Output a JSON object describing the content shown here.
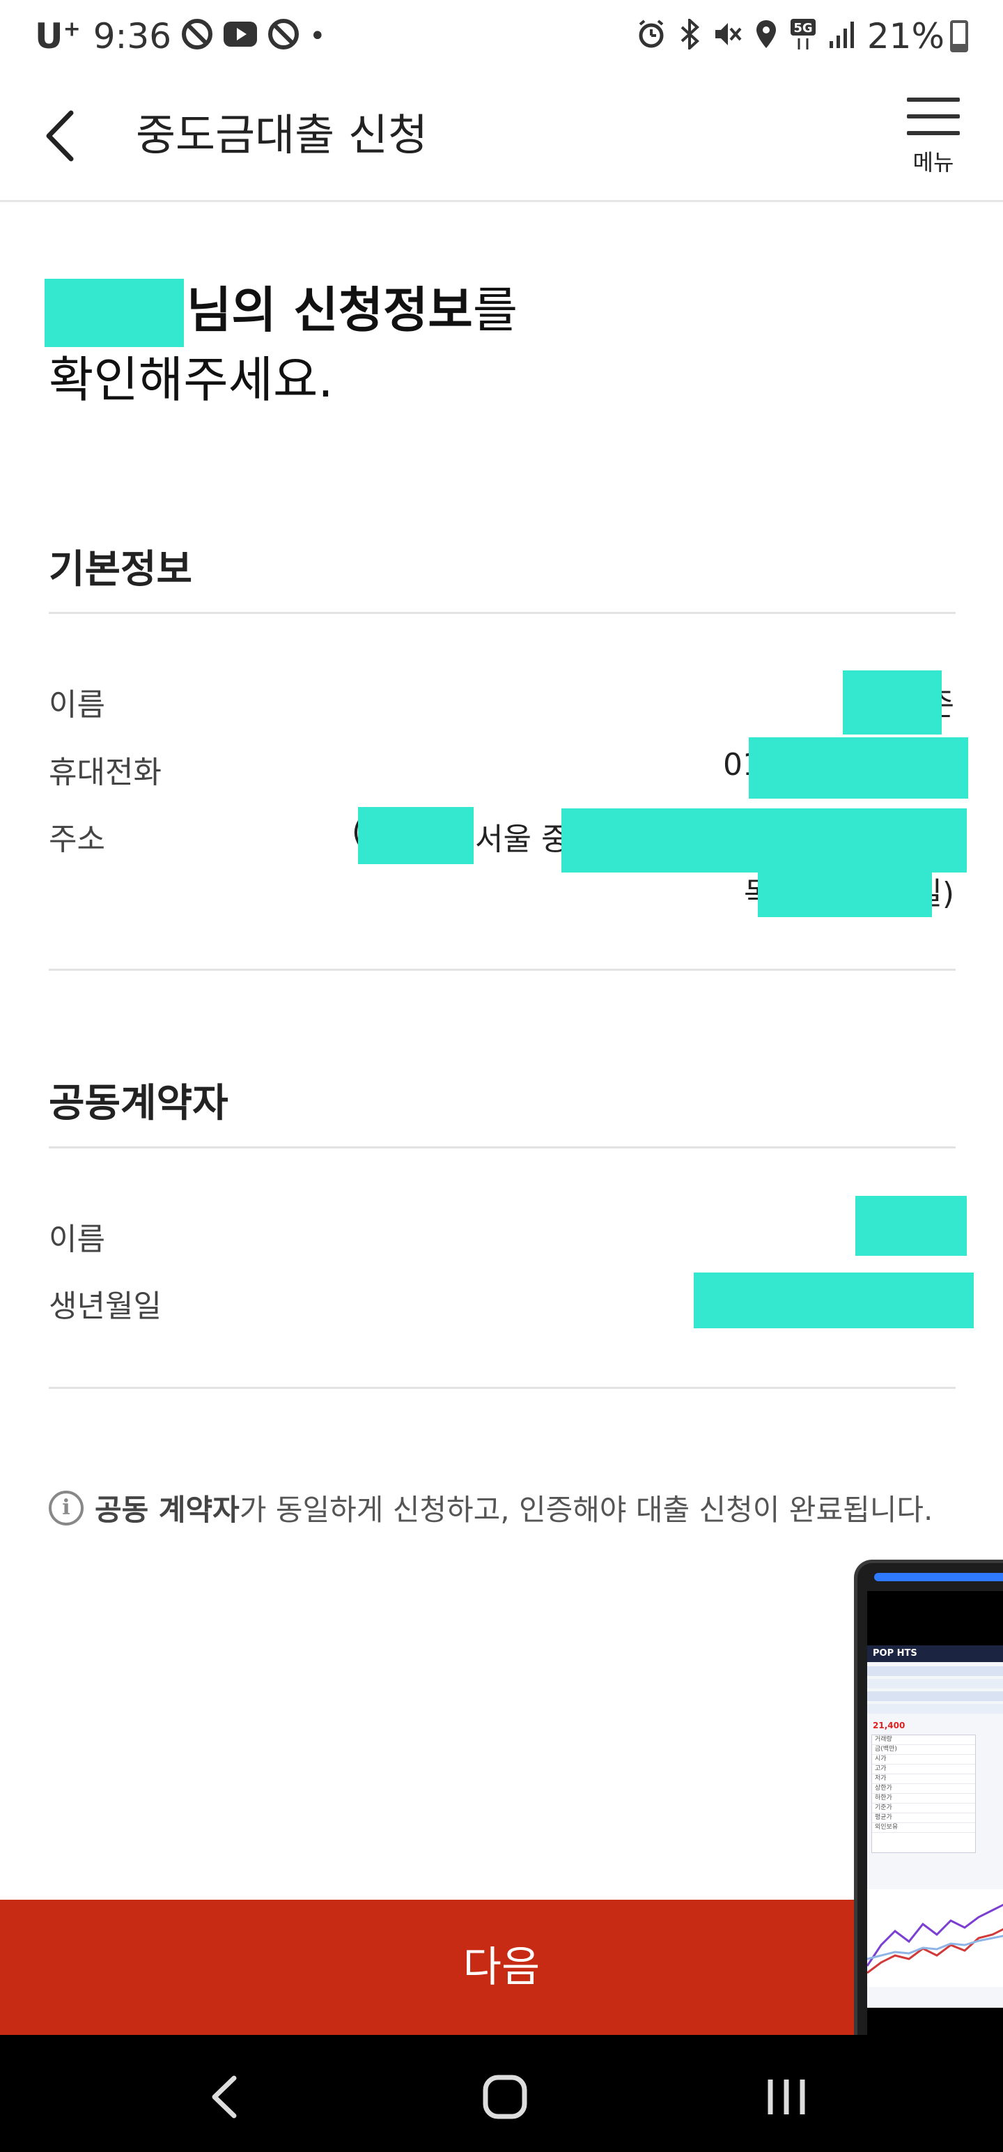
{
  "status_bar": {
    "carrier": "U",
    "carrier_sup": "+",
    "time": "9:36",
    "dot": "•",
    "battery": "21%",
    "icons_left": [
      "app-icon",
      "youtube-icon",
      "app-icon"
    ],
    "icons_right": [
      "alarm-icon",
      "bluetooth-icon",
      "mute-icon",
      "location-icon",
      "5g-icon",
      "signal-icon"
    ]
  },
  "header": {
    "title": "중도금대출 신청",
    "menu_label": "메뉴"
  },
  "greeting": {
    "line1_suffix_bold": "님의 신청정보",
    "line1_suffix": "를",
    "line2": "확인해주세요."
  },
  "basic_info": {
    "title": "기본정보",
    "name_label": "이름",
    "name_value_visible": "준",
    "phone_label": "휴대전화",
    "phone_value_visible": "01",
    "address_label": "주소",
    "address_line1_open": "(",
    "address_line1_visible": "서울 중",
    "address_line2_visible_start": "목",
    "address_line2_visible_end": "일)"
  },
  "co_signer": {
    "title": "공동계약자",
    "name_label": "이름",
    "birth_label": "생년월일"
  },
  "notice": {
    "icon": "i",
    "bold": "공동 계약자",
    "text": "가 동일하게 신청하고, 인증해야 대출 신청이 완료됩니다."
  },
  "next_button": {
    "label": "다음"
  },
  "floating_window": {
    "app_name": "POP HTS",
    "price": "21,400",
    "rows": [
      "거래량",
      "금(백만)",
      "시가",
      "고가",
      "저가",
      "상한가",
      "하한가",
      "기준가",
      "평균가",
      "외인보유"
    ]
  },
  "colors": {
    "accent": "#c72b14",
    "redaction": "#33e8cf",
    "nav_bar": "#000000"
  }
}
